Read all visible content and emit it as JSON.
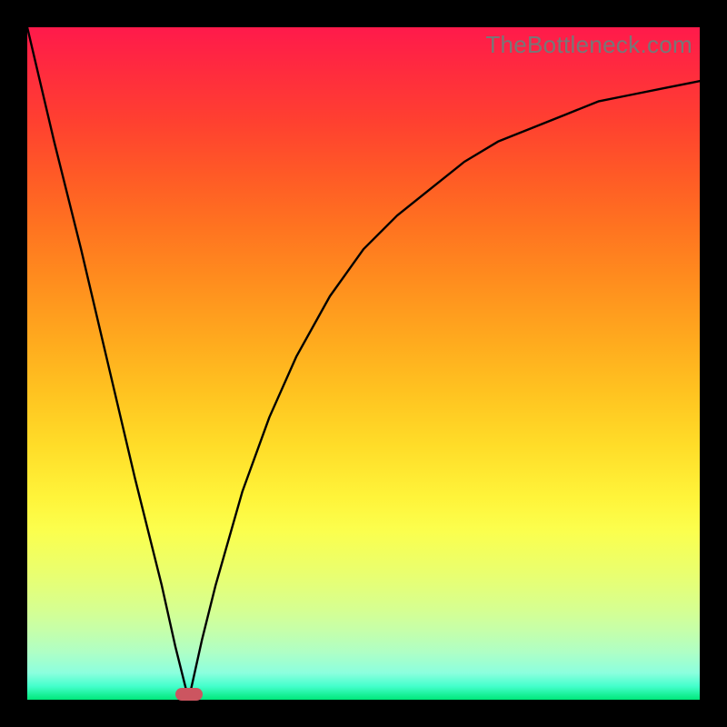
{
  "watermark": "TheBottleneck.com",
  "colors": {
    "frame": "#000000",
    "marker": "#cc5560",
    "curve": "#000000"
  },
  "chart_data": {
    "type": "line",
    "title": "",
    "xlabel": "",
    "ylabel": "",
    "xlim": [
      0,
      100
    ],
    "ylim": [
      0,
      100
    ],
    "grid": false,
    "legend": false,
    "annotations": [
      {
        "kind": "watermark",
        "text": "TheBottleneck.com",
        "position": "top-right"
      },
      {
        "kind": "marker",
        "x": 24,
        "y": 0,
        "shape": "pill",
        "color": "#cc5560"
      }
    ],
    "series": [
      {
        "name": "bottleneck-curve",
        "x": [
          0,
          4,
          8,
          12,
          16,
          20,
          22,
          24,
          26,
          28,
          32,
          36,
          40,
          45,
          50,
          55,
          60,
          65,
          70,
          75,
          80,
          85,
          90,
          95,
          100
        ],
        "y": [
          100,
          83,
          67,
          50,
          33,
          17,
          8,
          0,
          9,
          17,
          31,
          42,
          51,
          60,
          67,
          72,
          76,
          80,
          83,
          85,
          87,
          89,
          90,
          91,
          92
        ]
      }
    ],
    "minimum_x": 24
  }
}
